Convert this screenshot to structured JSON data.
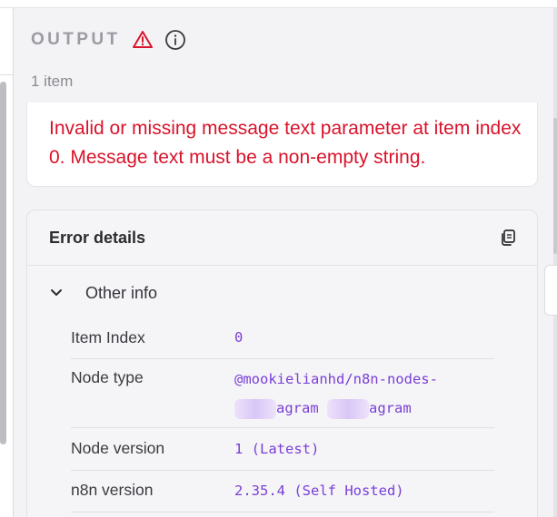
{
  "output": {
    "title": "OUTPUT",
    "item_count": "1 item"
  },
  "error": {
    "message": "Invalid or missing message text parameter at item index 0. Message text must be a non-empty string."
  },
  "details": {
    "title": "Error details",
    "section_label": "Other info",
    "rows": [
      {
        "key": "Item Index",
        "value": "0"
      },
      {
        "key": "Node type",
        "value_line1": "@mookielianhd/n8n-nodes-",
        "value_line2_part1": "agram",
        "value_line2_part2": "agram"
      },
      {
        "key": "Node version",
        "value": "1 (Latest)"
      },
      {
        "key": "n8n version",
        "value": "2.35.4 (Self Hosted)"
      }
    ]
  },
  "colors": {
    "error_red": "#d9132b",
    "mono_purple": "#7a3fd6",
    "muted_gray": "#9b9ba3"
  },
  "icons": {
    "warning": "warning-triangle-icon",
    "info": "info-circle-icon",
    "copy": "copy-icon",
    "chevron": "chevron-down-icon"
  }
}
